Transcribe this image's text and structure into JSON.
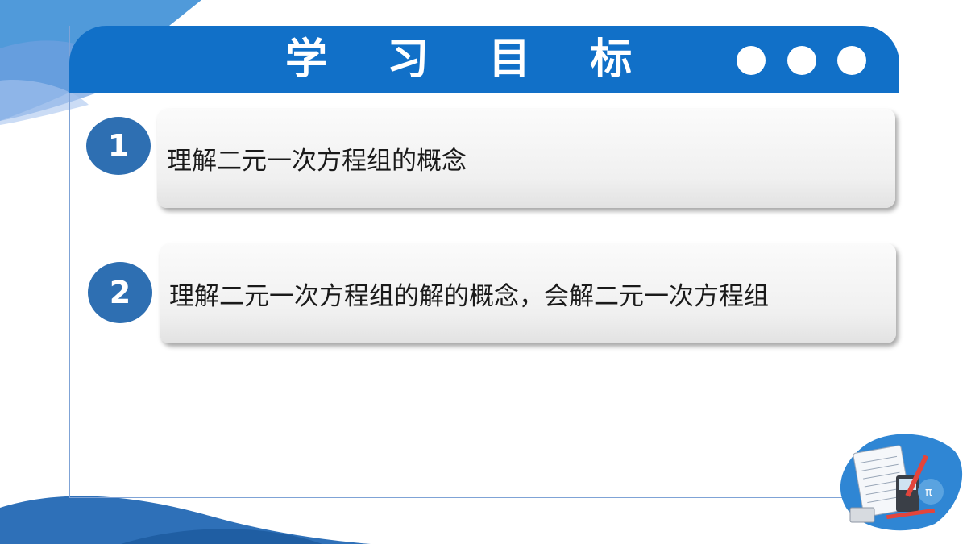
{
  "header": {
    "title": "学 习 目 标"
  },
  "goals": [
    {
      "number": "1",
      "text": "理解二元一次方程组的概念"
    },
    {
      "number": "2",
      "text": "理解二元一次方程组的解的概念，会解二元一次方程组"
    }
  ],
  "colors": {
    "primary": "#1170c8",
    "badge": "#2e6fb2",
    "frame": "#7fa3d6"
  },
  "illustration_icon": "math-desk-icon"
}
